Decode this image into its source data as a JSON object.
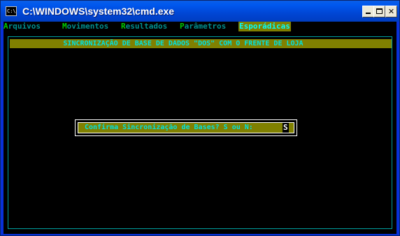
{
  "window": {
    "title": "C:\\WINDOWS\\system32\\cmd.exe",
    "icon_label": "C:\\",
    "buttons": {
      "minimize": "",
      "maximize": "",
      "close": "✕"
    }
  },
  "menu": {
    "items": [
      {
        "hotkey": "A",
        "rest": "rquivos"
      },
      {
        "hotkey": "M",
        "rest": "ovimentos"
      },
      {
        "hotkey": "R",
        "rest": "esultados"
      },
      {
        "hotkey": "P",
        "rest": "arâmetros"
      },
      {
        "hotkey": "E",
        "rest": "sporádicas"
      }
    ],
    "active": "Esporádicas"
  },
  "header": {
    "title": "SINCRONIZAÇÃO DE BASE DE DADOS \"DOS\" COM O FRENTE DE LOJA"
  },
  "dialog": {
    "prompt": "Confirma Sincronização de Bases? S ou N:",
    "answer": "S"
  },
  "colors": {
    "window_frame": "#0831d9",
    "console_bg": "#000000",
    "bar_bg": "#808000",
    "bar_text": "#00e0e0",
    "menu_text": "#008f8f",
    "menu_hotkey": "#00cc00",
    "panel_border": "#00a0a0"
  }
}
